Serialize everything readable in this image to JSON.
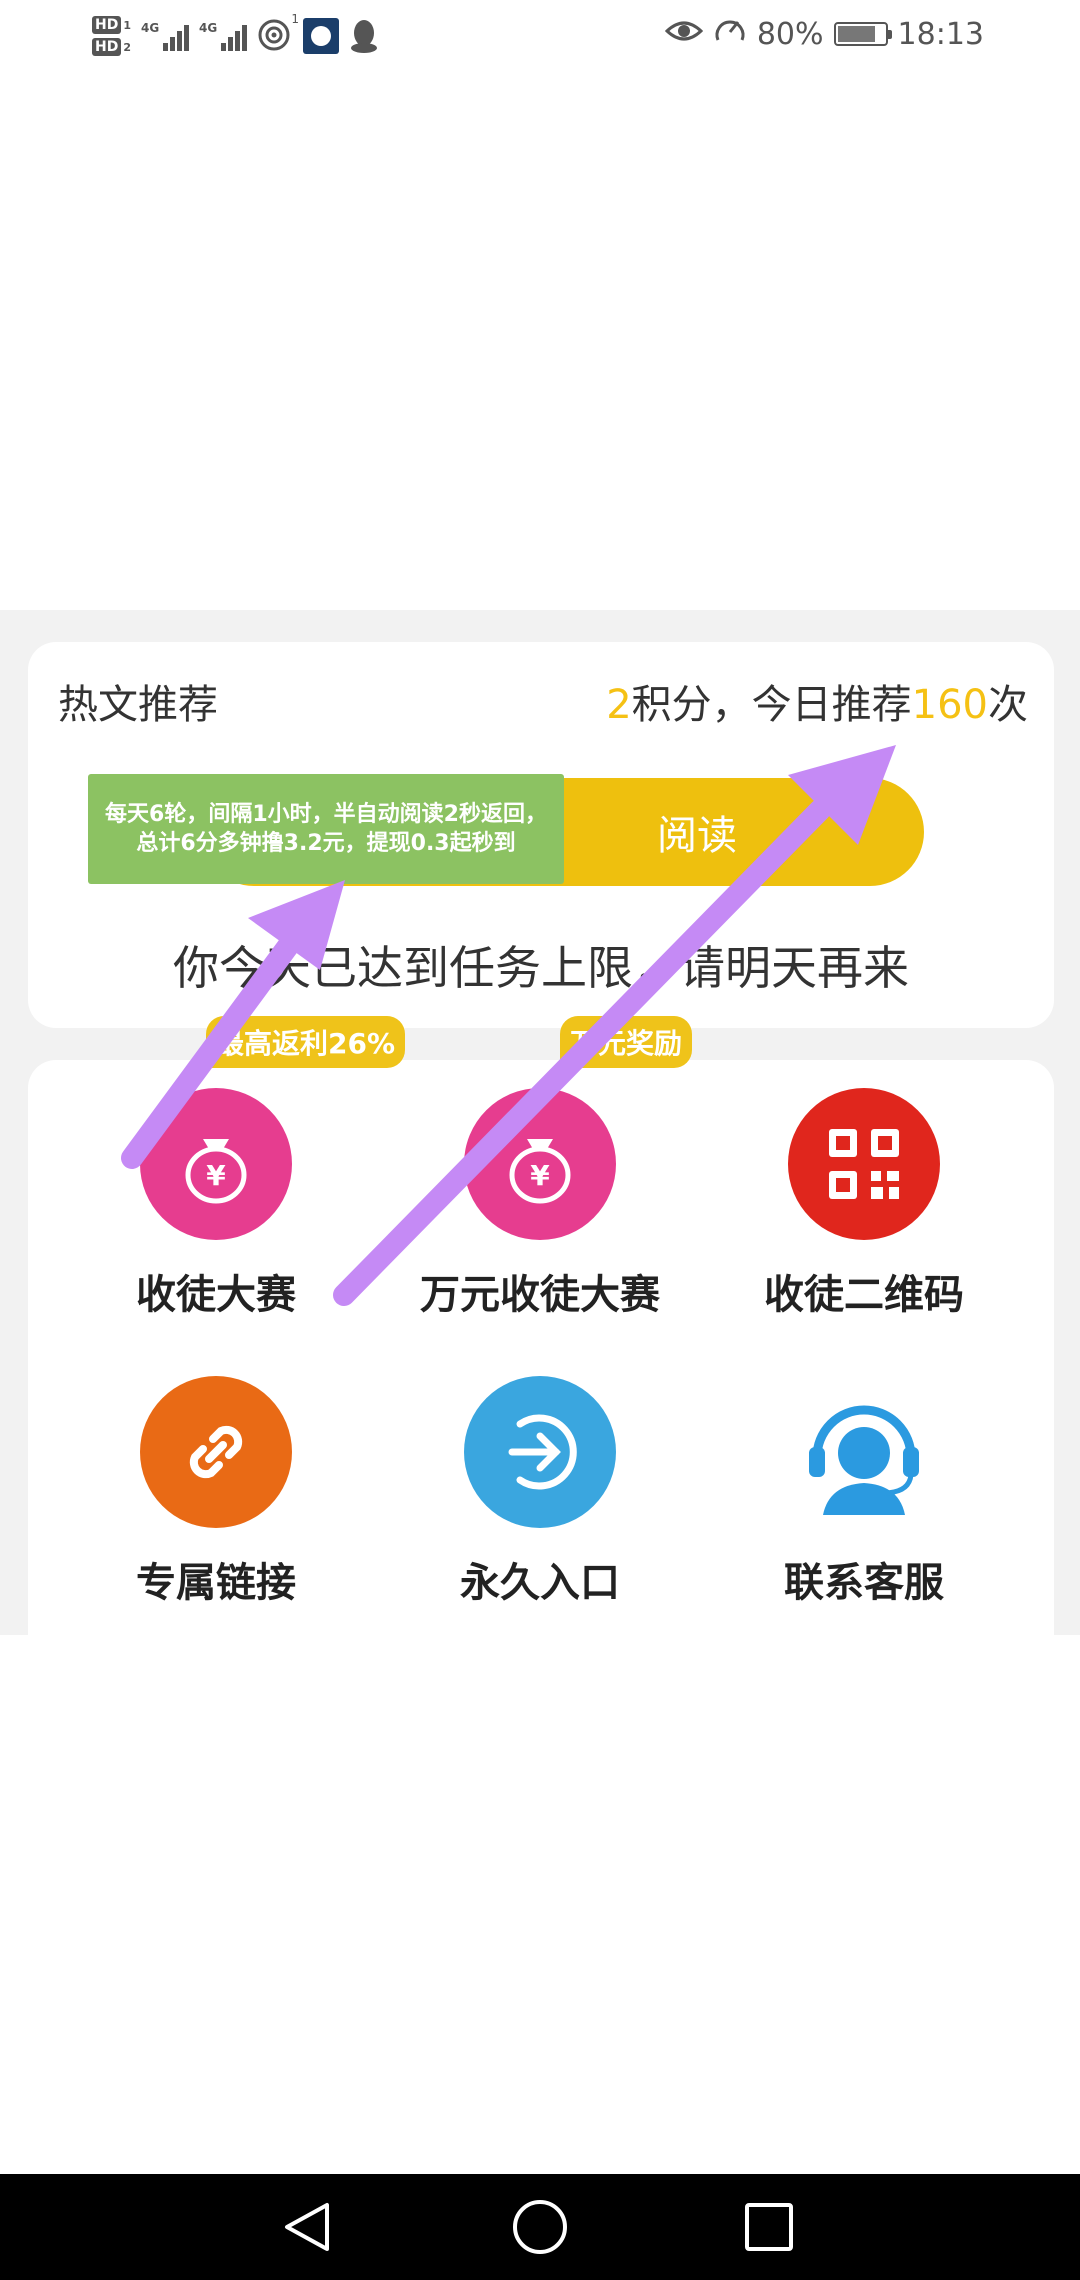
{
  "status_bar": {
    "hd1": "HD",
    "hd1_sub": "1",
    "hd2": "HD",
    "hd2_sub": "2",
    "net1": "4G",
    "net2": "4G",
    "hotspot_sup": "1",
    "battery_pct": "80%",
    "battery_level": 0.8,
    "time": "18:13"
  },
  "hot": {
    "title": "热文推荐",
    "points": "2",
    "points_label": "积分，今日推荐",
    "count": "160",
    "count_label": "次",
    "read_button": "阅读",
    "limit_message": "你今天已达到任务上限，请明天再来"
  },
  "annotation": "每天6轮，间隔1小时，半自动阅读2秒返回，总计6分多钟撸3.2元，提现0.3起秒到",
  "grid": {
    "items": [
      {
        "label": "收徒大赛",
        "badge": "最高返利26%"
      },
      {
        "label": "万元收徒大赛",
        "badge": "万元奖励"
      },
      {
        "label": "收徒二维码"
      },
      {
        "label": "专属链接"
      },
      {
        "label": "永久入口"
      },
      {
        "label": "联系客服"
      }
    ]
  },
  "colors": {
    "accent_yellow": "#eec00e",
    "money_pink": "#e63d8f",
    "qr_red": "#e0261d",
    "link_orange": "#e96a15",
    "entry_blue": "#3aa6df",
    "service_blue": "#2b9ae0",
    "annotation_green": "#8cc262",
    "arrow_purple": "#c58af5"
  }
}
